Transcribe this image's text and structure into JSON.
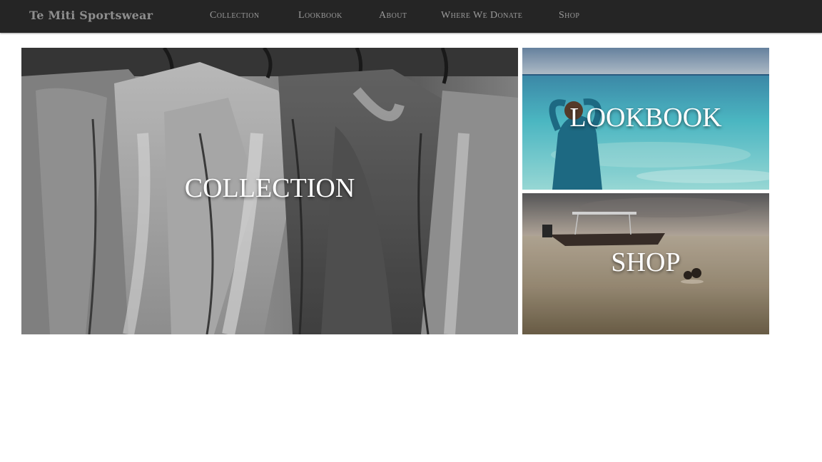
{
  "brand": {
    "name": "Te Miti Sportswear"
  },
  "nav": {
    "items": [
      {
        "label": "Collection"
      },
      {
        "label": "Lookbook"
      },
      {
        "label": "About"
      },
      {
        "label": "Where We Donate"
      },
      {
        "label": "Shop"
      }
    ]
  },
  "tiles": {
    "collection": {
      "label": "COLLECTION"
    },
    "lookbook": {
      "label": "LOOKBOOK"
    },
    "shop": {
      "label": "SHOP"
    }
  },
  "colors": {
    "navbar_bg": "#252525",
    "nav_text": "#9a9a9a",
    "tile_label": "#ffffff",
    "page_bg": "#ffffff"
  }
}
